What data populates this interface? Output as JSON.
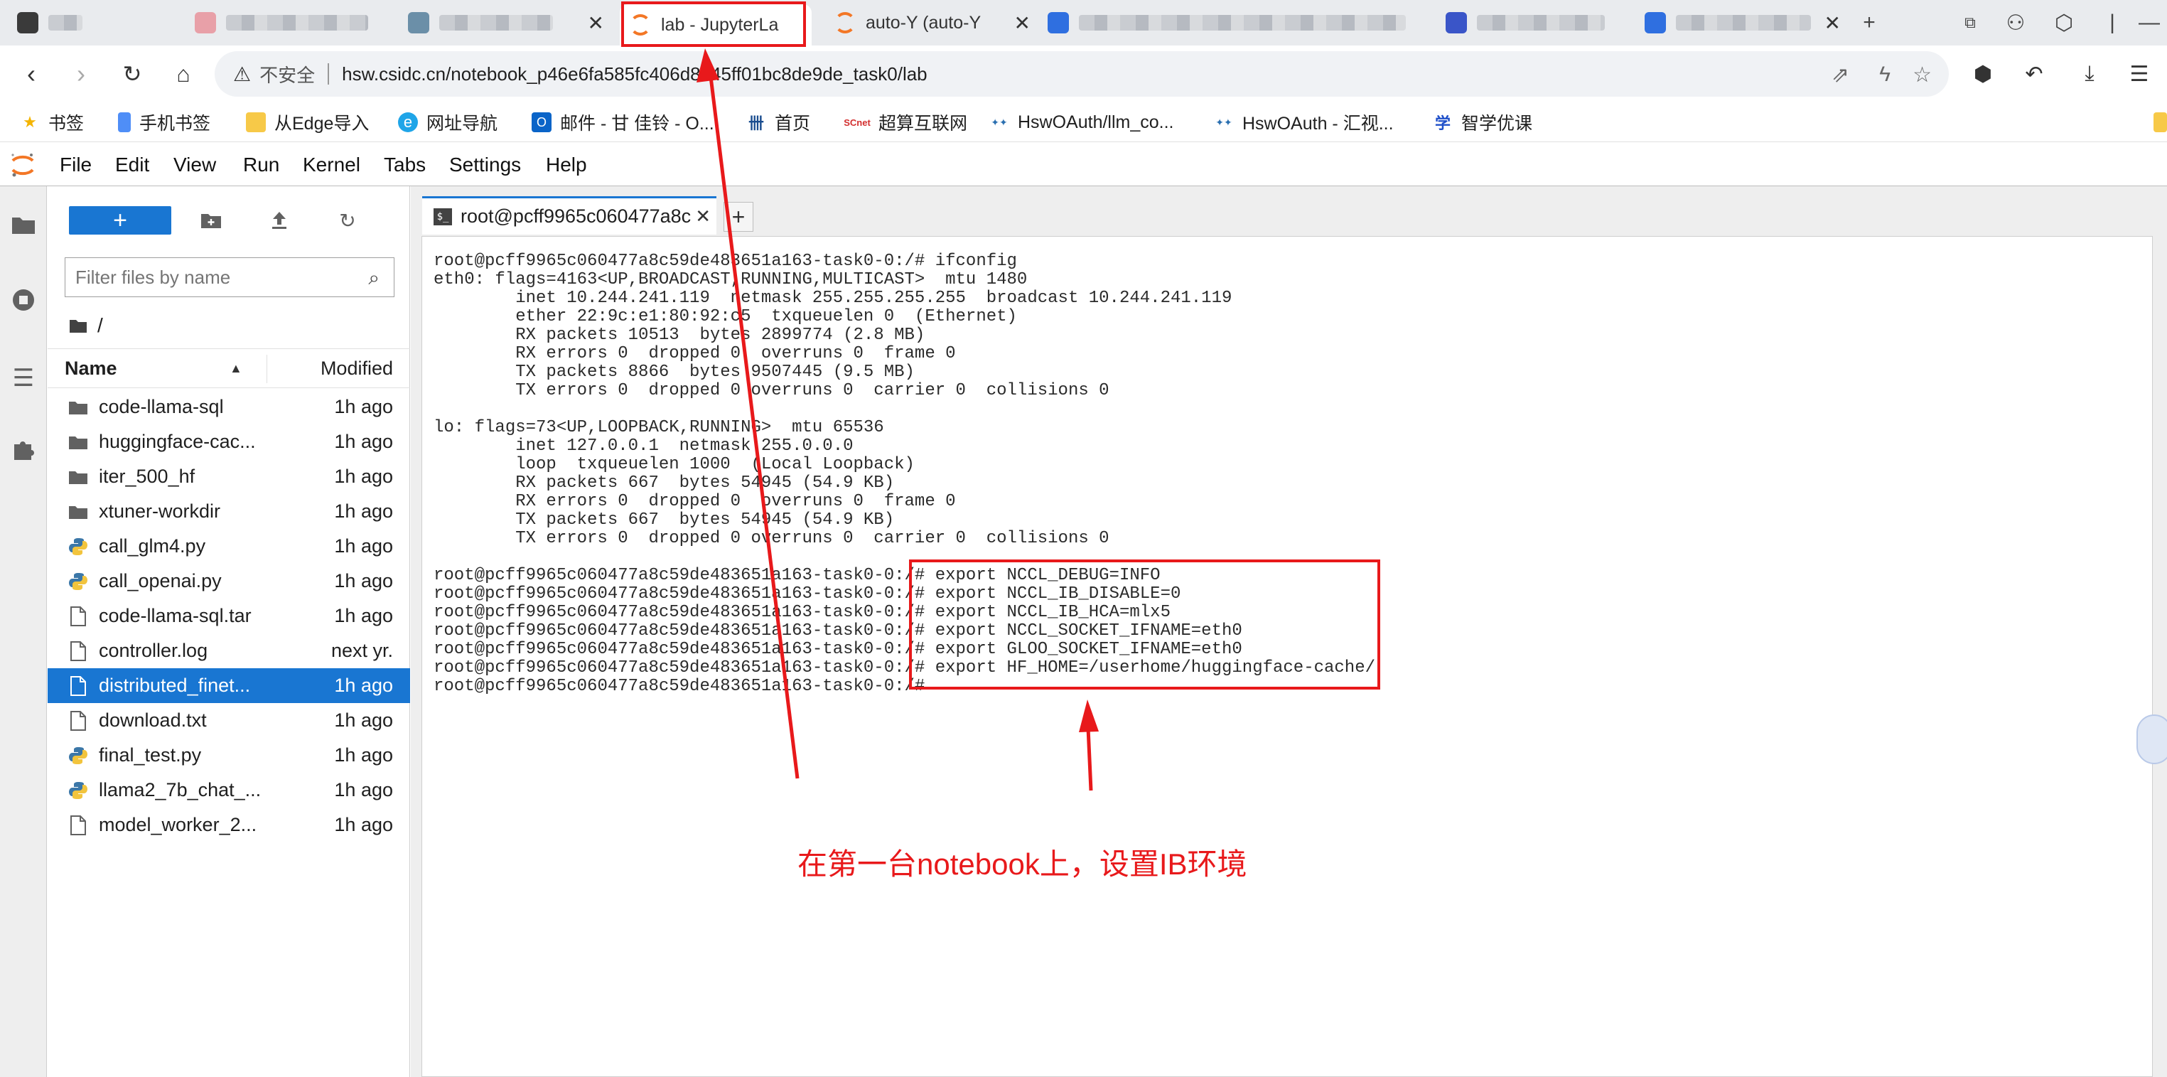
{
  "browser": {
    "tabs": [
      {
        "label": "",
        "blurred": true
      },
      {
        "label": "",
        "blurred": true
      },
      {
        "label": "",
        "blurred": true
      },
      {
        "label": "lab - JupyterLa",
        "active": true
      },
      {
        "label": "auto-Y (auto-Y"
      },
      {
        "label": "",
        "blurred": true
      },
      {
        "label": "",
        "blurred": true
      },
      {
        "label": "",
        "blurred": true
      }
    ],
    "new_tab": "+",
    "address": {
      "warning_icon": "warning-triangle-icon",
      "security_label": "不安全",
      "url": "hsw.csidc.cn/notebook_p46e6fa585fc406d8a45ff01bc8de9de_task0/lab"
    },
    "bookmarks": [
      {
        "label": "书签",
        "icon": "star-icon"
      },
      {
        "label": "手机书签",
        "icon": "phone-icon"
      },
      {
        "label": "从Edge导入",
        "icon": "folder-icon"
      },
      {
        "label": "网址导航",
        "icon": "compass-icon"
      },
      {
        "label": "邮件 - 甘 佳铃 - O...",
        "icon": "outlook-icon"
      },
      {
        "label": "首页",
        "icon": "home-logo-icon"
      },
      {
        "label": "超算互联网",
        "icon": "scnet-icon"
      },
      {
        "label": "HswOAuth/llm_co...",
        "icon": "hsw-icon"
      },
      {
        "label": "HswOAuth - 汇视...",
        "icon": "hsw-icon"
      },
      {
        "label": "智学优课",
        "icon": "course-icon"
      }
    ]
  },
  "jupyter": {
    "menu": [
      "File",
      "Edit",
      "View",
      "Run",
      "Kernel",
      "Tabs",
      "Settings",
      "Help"
    ],
    "new_button": "+",
    "filter_placeholder": "Filter files by name",
    "breadcrumb": "/",
    "list_header": {
      "name": "Name",
      "modified": "Modified"
    },
    "files": [
      {
        "name": "code-llama-sql",
        "modified": "1h ago",
        "type": "folder"
      },
      {
        "name": "huggingface-cac...",
        "modified": "1h ago",
        "type": "folder"
      },
      {
        "name": "iter_500_hf",
        "modified": "1h ago",
        "type": "folder"
      },
      {
        "name": "xtuner-workdir",
        "modified": "1h ago",
        "type": "folder"
      },
      {
        "name": "call_glm4.py",
        "modified": "1h ago",
        "type": "python"
      },
      {
        "name": "call_openai.py",
        "modified": "1h ago",
        "type": "python"
      },
      {
        "name": "code-llama-sql.tar",
        "modified": "1h ago",
        "type": "file"
      },
      {
        "name": "controller.log",
        "modified": "next yr.",
        "type": "file"
      },
      {
        "name": "distributed_finet...",
        "modified": "1h ago",
        "type": "file",
        "selected": true
      },
      {
        "name": "download.txt",
        "modified": "1h ago",
        "type": "file"
      },
      {
        "name": "final_test.py",
        "modified": "1h ago",
        "type": "python"
      },
      {
        "name": "llama2_7b_chat_...",
        "modified": "1h ago",
        "type": "python"
      },
      {
        "name": "model_worker_2...",
        "modified": "1h ago",
        "type": "file"
      }
    ],
    "doc_tab": {
      "label": "root@pcff9965c060477a8c",
      "icon_text": "$_"
    },
    "add_tab": "+",
    "terminal_lines": [
      "root@pcff9965c060477a8c59de483651a163-task0-0:/# ifconfig",
      "eth0: flags=4163<UP,BROADCAST,RUNNING,MULTICAST>  mtu 1480",
      "        inet 10.244.241.119  netmask 255.255.255.255  broadcast 10.244.241.119",
      "        ether 22:9c:e1:80:92:c5  txqueuelen 0  (Ethernet)",
      "        RX packets 10513  bytes 2899774 (2.8 MB)",
      "        RX errors 0  dropped 0  overruns 0  frame 0",
      "        TX packets 8866  bytes 9507445 (9.5 MB)",
      "        TX errors 0  dropped 0 overruns 0  carrier 0  collisions 0",
      "",
      "lo: flags=73<UP,LOOPBACK,RUNNING>  mtu 65536",
      "        inet 127.0.0.1  netmask 255.0.0.0",
      "        loop  txqueuelen 1000  (Local Loopback)",
      "        RX packets 667  bytes 54945 (54.9 KB)",
      "        RX errors 0  dropped 0  overruns 0  frame 0",
      "        TX packets 667  bytes 54945 (54.9 KB)",
      "        TX errors 0  dropped 0 overruns 0  carrier 0  collisions 0",
      "",
      "root@pcff9965c060477a8c59de483651a163-task0-0:/# export NCCL_DEBUG=INFO",
      "root@pcff9965c060477a8c59de483651a163-task0-0:/# export NCCL_IB_DISABLE=0",
      "root@pcff9965c060477a8c59de483651a163-task0-0:/# export NCCL_IB_HCA=mlx5",
      "root@pcff9965c060477a8c59de483651a163-task0-0:/# export NCCL_SOCKET_IFNAME=eth0",
      "root@pcff9965c060477a8c59de483651a163-task0-0:/# export GLOO_SOCKET_IFNAME=eth0",
      "root@pcff9965c060477a8c59de483651a163-task0-0:/# export HF_HOME=/userhome/huggingface-cache/",
      "root@pcff9965c060477a8c59de483651a163-task0-0:/# "
    ]
  },
  "annotation": {
    "text": "在第一台notebook上，设置IB环境",
    "color": "#e8191b"
  },
  "colors": {
    "accent": "#1976d2",
    "jupyter_orange": "#f37726",
    "annotation_red": "#e8191b"
  }
}
